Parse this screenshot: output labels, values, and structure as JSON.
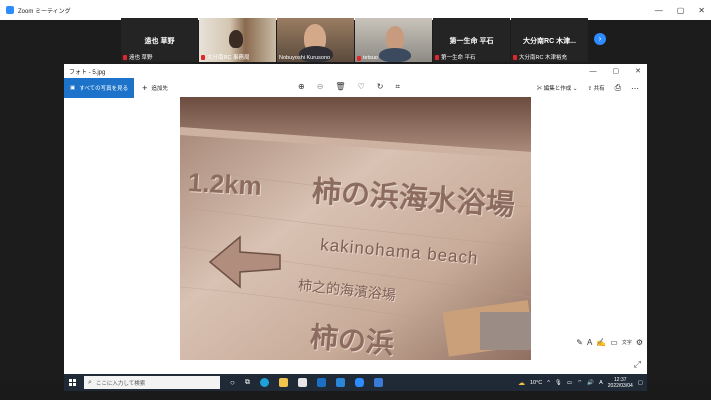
{
  "zoom": {
    "title": "Zoom ミーティング",
    "controls": [
      "—",
      "▢",
      "✕"
    ]
  },
  "participants": [
    {
      "display": "遠也 草野",
      "label": "遠也 草野",
      "video": false
    },
    {
      "display": "",
      "label": "大分南RC 事務局",
      "video": true
    },
    {
      "display": "",
      "label": "Nobuyoshi Kurusono",
      "video": true
    },
    {
      "display": "",
      "label": "tetsuo",
      "video": true
    },
    {
      "display": "第一生命 平石",
      "label": "第一生命 平石",
      "video": false
    },
    {
      "display": "大分南RC 木津...",
      "label": "大分南RC 木津裕充",
      "video": false
    }
  ],
  "photos_app": {
    "title": "フォト - 5.jpg",
    "all_photos_label": "すべての写真を見る",
    "add_to_label": "追加先",
    "edit_create_label": "編集と作成",
    "share_label": "共有",
    "icons": [
      "zoom-in-icon",
      "zoom-out-icon",
      "delete-icon",
      "favorite-icon",
      "rotate-icon",
      "crop-icon"
    ]
  },
  "photo": {
    "distance": "1.2km",
    "place_jp": "柿の浜海水浴場",
    "place_romaji": "kakinohama beach",
    "place_cn": "柿之的海濱浴場",
    "bottom_partial": "柿の浜"
  },
  "taskbar": {
    "search_placeholder": "ここに入力して検索",
    "temperature": "10°C",
    "ime": "A",
    "time": "12:37",
    "date": "2022/03/04"
  },
  "colors": {
    "accent_blue": "#1c73c9",
    "zoom_blue": "#2d8cff",
    "taskbar": "#1f2a36"
  }
}
